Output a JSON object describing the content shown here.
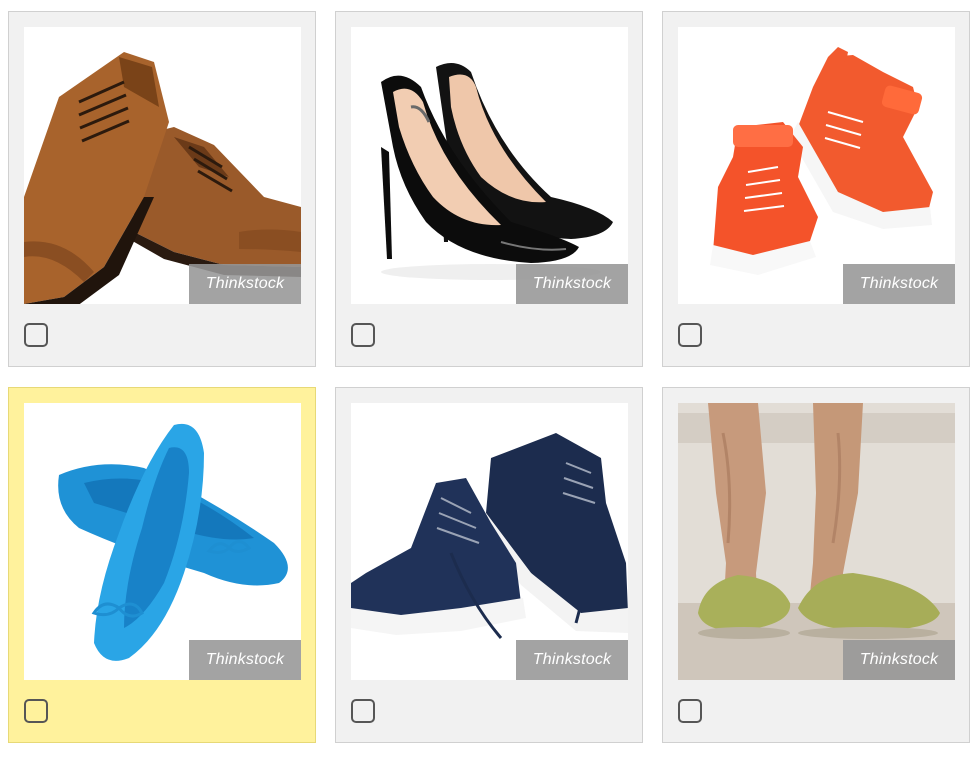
{
  "grid": {
    "items": [
      {
        "image": "brown-leather-oxford-shoes",
        "credit": "Thinkstock",
        "checked": false,
        "highlighted": false
      },
      {
        "image": "black-patent-stiletto-heels",
        "credit": "Thinkstock",
        "checked": false,
        "highlighted": false
      },
      {
        "image": "orange-high-top-sneakers",
        "credit": "Thinkstock",
        "checked": false,
        "highlighted": false
      },
      {
        "image": "blue-ballet-flats",
        "credit": "Thinkstock",
        "checked": false,
        "highlighted": true
      },
      {
        "image": "navy-suede-chukka-sneakers",
        "credit": "Thinkstock",
        "checked": false,
        "highlighted": false
      },
      {
        "image": "green-fuzzy-slippers",
        "credit": "Thinkstock",
        "checked": false,
        "highlighted": false
      }
    ]
  },
  "colors": {
    "card_background": "#f1f1f1",
    "card_selected_background": "#fff29c",
    "card_border": "#d0d0d0",
    "credit_background": "#969696",
    "checkbox_border": "#565656"
  }
}
